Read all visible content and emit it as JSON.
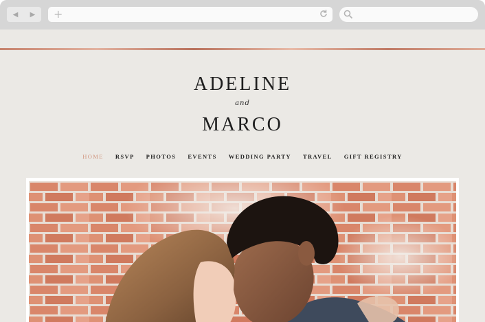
{
  "browser": {
    "back_icon": "back-arrow-icon",
    "forward_icon": "forward-arrow-icon",
    "new_tab_icon": "plus-icon",
    "reload_icon": "reload-icon",
    "search_icon": "search-icon"
  },
  "site": {
    "accent_color": "#d19781",
    "name_first": "ADELINE",
    "conjunction": "and",
    "name_second": "MARCO",
    "nav": [
      {
        "label": "HOME",
        "active": true
      },
      {
        "label": "RSVP"
      },
      {
        "label": "PHOTOS"
      },
      {
        "label": "EVENTS"
      },
      {
        "label": "WEDDING PARTY"
      },
      {
        "label": "TRAVEL"
      },
      {
        "label": "GIFT REGISTRY"
      }
    ]
  }
}
